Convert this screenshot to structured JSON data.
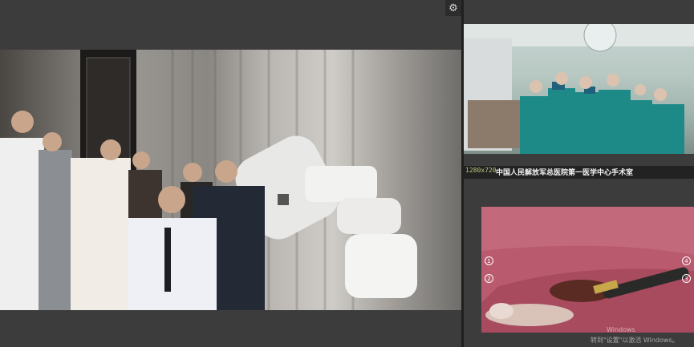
{
  "main": {
    "settings_icon": "gear-icon",
    "settings_glyph": "⚙"
  },
  "cam2": {
    "resolution": "1280x720",
    "caption": "中国人民解放军总医院第一医学中心手术室"
  },
  "cam3": {
    "markers": [
      "1",
      "2",
      "4",
      "3"
    ]
  },
  "watermark": {
    "line1": "Windows",
    "line2": "转到\"设置\"以激活 Windows。"
  },
  "colors": {
    "background": "#3c3c3c",
    "caption_bar": "#222222",
    "resolution_text": "#b9c97a"
  }
}
